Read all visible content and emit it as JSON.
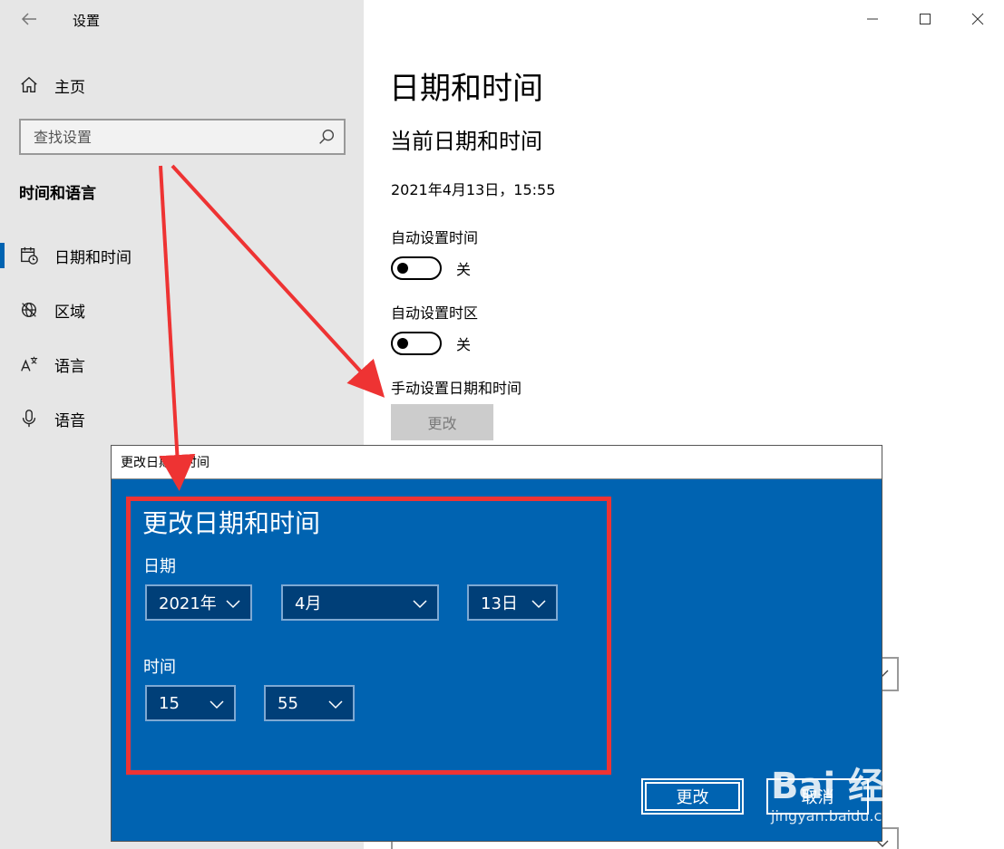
{
  "app": {
    "title": "设置"
  },
  "sidebar": {
    "home_label": "主页",
    "search_placeholder": "查找设置",
    "section_title": "时间和语言",
    "items": [
      {
        "label": "日期和时间",
        "icon": "calendar-clock-icon",
        "selected": true
      },
      {
        "label": "区域",
        "icon": "globe-icon",
        "selected": false
      },
      {
        "label": "语言",
        "icon": "language-icon",
        "selected": false
      },
      {
        "label": "语音",
        "icon": "microphone-icon",
        "selected": false
      }
    ]
  },
  "main": {
    "title": "日期和时间",
    "subtitle": "当前日期和时间",
    "current_datetime": "2021年4月13日，15:55",
    "auto_time_label": "自动设置时间",
    "auto_time_state": "关",
    "auto_timezone_label": "自动设置时区",
    "auto_timezone_state": "关",
    "manual_label": "手动设置日期和时间",
    "change_button": "更改"
  },
  "dialog": {
    "window_title": "更改日期和时间",
    "heading": "更改日期和时间",
    "date_label": "日期",
    "year": "2021年",
    "month": "4月",
    "day": "13日",
    "time_label": "时间",
    "hour": "15",
    "minute": "55",
    "confirm_button": "更改",
    "cancel_button": "取消"
  },
  "watermark": {
    "brand": "Bai  经验",
    "url": "jingyan.baidu.com"
  },
  "colors": {
    "accent": "#0063b1",
    "annotation": "#ee3333",
    "sidebar_bg": "#e6e6e6"
  }
}
